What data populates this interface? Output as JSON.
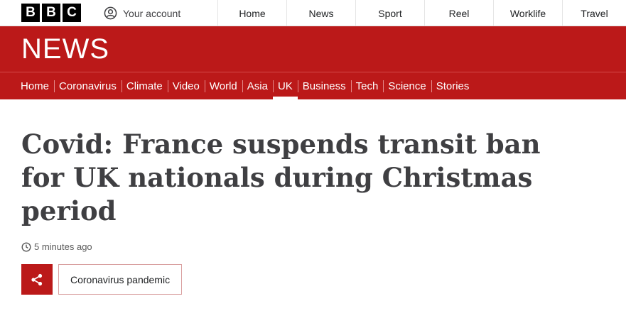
{
  "logo": {
    "letters": [
      "B",
      "B",
      "C"
    ]
  },
  "account": {
    "label": "Your account",
    "icon": "user-account-icon"
  },
  "top_nav": {
    "items": [
      {
        "label": "Home"
      },
      {
        "label": "News"
      },
      {
        "label": "Sport"
      },
      {
        "label": "Reel"
      },
      {
        "label": "Worklife"
      },
      {
        "label": "Travel"
      }
    ]
  },
  "news_band": {
    "wordmark": "NEWS",
    "color": "#bb1919",
    "sections": [
      {
        "label": "Home"
      },
      {
        "label": "Coronavirus"
      },
      {
        "label": "Climate"
      },
      {
        "label": "Video"
      },
      {
        "label": "World"
      },
      {
        "label": "Asia"
      },
      {
        "label": "UK",
        "active": true
      },
      {
        "label": "Business"
      },
      {
        "label": "Tech"
      },
      {
        "label": "Science"
      },
      {
        "label": "Stories"
      }
    ]
  },
  "article": {
    "headline": "Covid: France suspends transit ban for UK nationals during Christmas period",
    "timestamp": "5 minutes ago",
    "timestamp_icon": "clock-icon",
    "share_icon": "share-icon",
    "tag": "Coronavirus pandemic"
  }
}
